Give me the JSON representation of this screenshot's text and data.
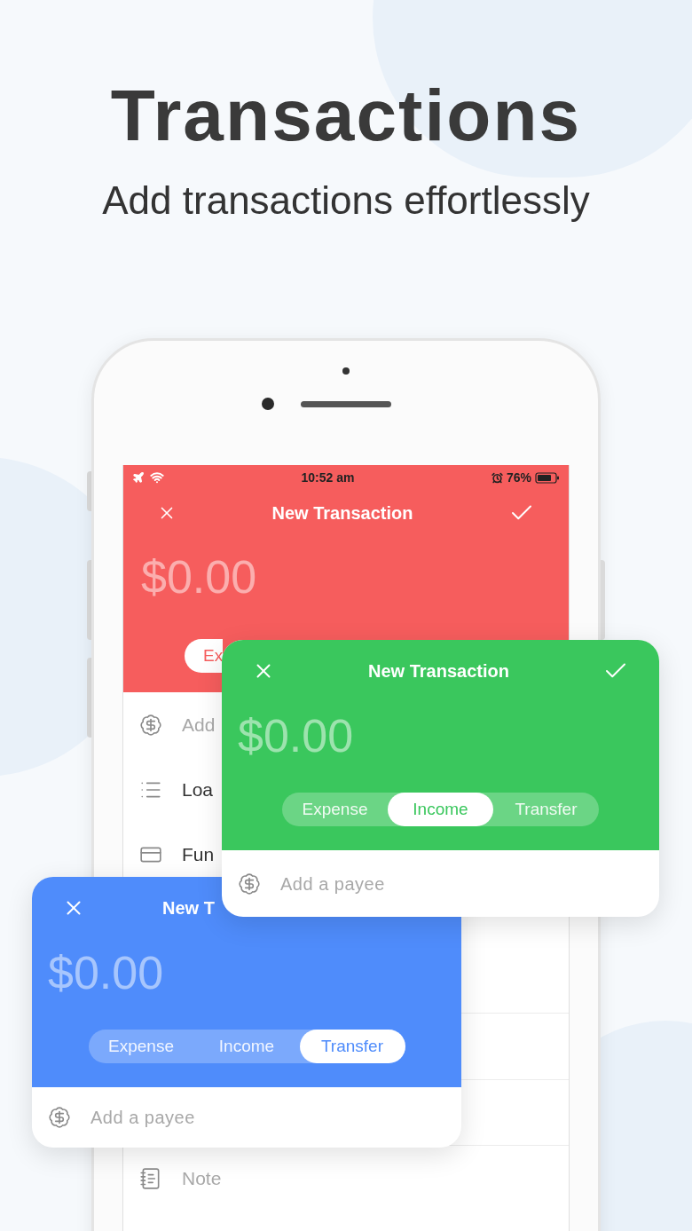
{
  "headline": "Transactions",
  "subheadline": "Add transactions effortlessly",
  "status_bar": {
    "time": "10:52 am",
    "battery": "76%"
  },
  "phone_screen": {
    "color": "#f65d5d",
    "title": "New Transaction",
    "amount": "$0.00",
    "segments": [
      {
        "label": "Ex",
        "selected": true
      }
    ],
    "rows": [
      {
        "kind": "payee",
        "label": "Add"
      },
      {
        "kind": "list",
        "label": "Loa"
      },
      {
        "kind": "card",
        "label": "Fun"
      },
      {
        "kind": "note",
        "label": "Note"
      }
    ]
  },
  "cards": [
    {
      "color": "#3ac75d",
      "title": "New Transaction",
      "amount": "$0.00",
      "confirm": true,
      "segments": [
        {
          "label": "Expense",
          "selected": false
        },
        {
          "label": "Income",
          "selected": true
        },
        {
          "label": "Transfer",
          "selected": false
        }
      ],
      "payee_placeholder": "Add a payee"
    },
    {
      "color": "#4f8cfb",
      "title": "New T",
      "amount": "$0.00",
      "confirm": false,
      "segments": [
        {
          "label": "Expense",
          "selected": false
        },
        {
          "label": "Income",
          "selected": false
        },
        {
          "label": "Transfer",
          "selected": true
        }
      ],
      "payee_placeholder": "Add a payee"
    }
  ]
}
